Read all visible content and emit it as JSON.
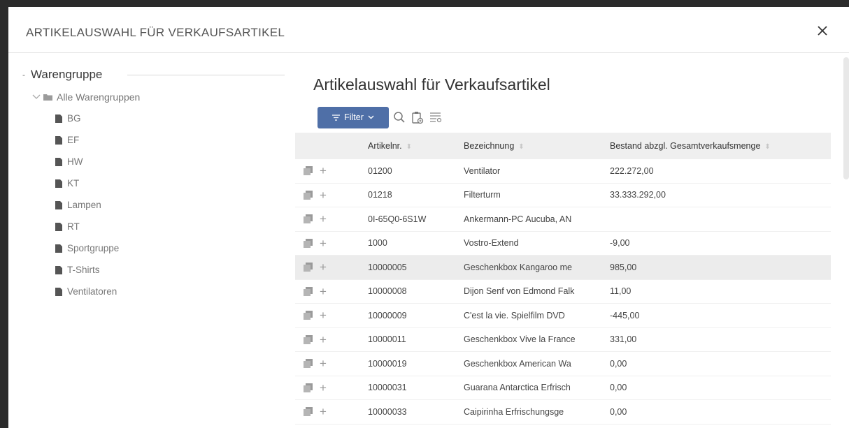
{
  "dialog": {
    "title": "ARTIKELAUSWAHL FÜR VERKAUFSARTIKEL",
    "close_glyph": "✕"
  },
  "sidebar": {
    "section_toggle": "-",
    "section_title": "Warengruppe",
    "root_label": "Alle Warengruppen",
    "items": [
      {
        "label": "BG"
      },
      {
        "label": "EF"
      },
      {
        "label": "HW"
      },
      {
        "label": "KT"
      },
      {
        "label": "Lampen"
      },
      {
        "label": "RT"
      },
      {
        "label": "Sportgruppe"
      },
      {
        "label": "T-Shirts"
      },
      {
        "label": "Ventilatoren"
      }
    ]
  },
  "main": {
    "title": "Artikelauswahl für Verkaufsartikel",
    "filter_label": "Filter",
    "icons": [
      "filter-icon",
      "chevron-down-icon",
      "search-icon",
      "clipboard-icon",
      "column-settings-icon",
      "copy-icon",
      "plus-icon",
      "close-icon",
      "folder-icon",
      "document-icon"
    ],
    "table": {
      "columns": [
        "Artikelnr.",
        "Bezeichnung",
        "Bestand abzgl. Gesamtverkaufsmenge"
      ],
      "rows": [
        {
          "nr": "01200",
          "bez": "Ventilator",
          "bestand": "222.272,00"
        },
        {
          "nr": "01218",
          "bez": "Filterturm",
          "bestand": "33.333.292,00"
        },
        {
          "nr": "0I-65Q0-6S1W",
          "bez": "Ankermann-PC Aucuba, AN",
          "bestand": ""
        },
        {
          "nr": "1000",
          "bez": "Vostro-Extend",
          "bestand": "-9,00"
        },
        {
          "nr": "10000005",
          "bez": "Geschenkbox Kangaroo me",
          "bestand": "985,00",
          "highlight": true
        },
        {
          "nr": "10000008",
          "bez": "Dijon Senf von Edmond Falk",
          "bestand": "11,00"
        },
        {
          "nr": "10000009",
          "bez": "C'est la vie. Spielfilm DVD",
          "bestand": "-445,00"
        },
        {
          "nr": "10000011",
          "bez": "Geschenkbox Vive la France",
          "bestand": "331,00"
        },
        {
          "nr": "10000019",
          "bez": "Geschenkbox American Wa",
          "bestand": "0,00"
        },
        {
          "nr": "10000031",
          "bez": "Guarana Antarctica Erfrisch",
          "bestand": "0,00"
        },
        {
          "nr": "10000033",
          "bez": "Caipirinha Erfrischungsge",
          "bestand": "0,00"
        }
      ]
    }
  },
  "colors": {
    "accent": "#4f6fa7",
    "header_bg": "#efefef",
    "highlight_row": "#ececec",
    "muted_text": "#777777"
  }
}
